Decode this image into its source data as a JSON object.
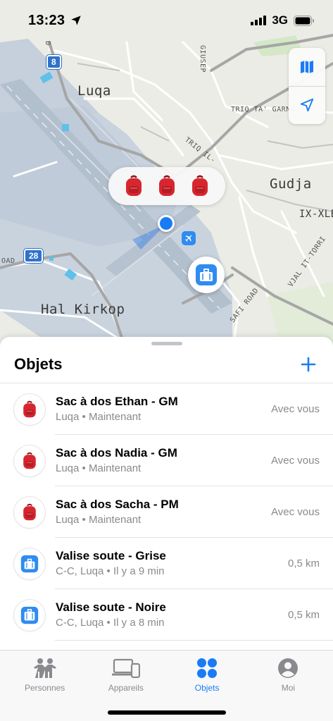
{
  "status_bar": {
    "time": "13:23",
    "network": "3G",
    "icons": [
      "location-arrow-icon",
      "signal-bars-icon",
      "battery-icon"
    ]
  },
  "map": {
    "labels": {
      "luqa": "Luqa",
      "gudja": "Gudja",
      "hal_kirkop": "Hal Kirkop",
      "triq_ta_garna": "TRIQ TA' GARNA",
      "triq_il": "TRIQ IL-",
      "ix_xlej": "IX-XLEJ",
      "oad": "OAD",
      "safi_road": "SAFI ROAD",
      "vjal_it_torri": "VJAL IT-TORRI",
      "giuseppe": "GIUSEP",
      "road_d": "D"
    },
    "route_shields": {
      "top": "8",
      "left": "28"
    },
    "controls": [
      "map-mode-icon",
      "locate-me-icon"
    ],
    "cluster_items": [
      "backpack-icon",
      "backpack-icon",
      "backpack-icon"
    ]
  },
  "sheet": {
    "title": "Objets",
    "add_icon": "plus-icon",
    "items": [
      {
        "name": "Sac à dos Ethan - GM",
        "place": "Luqa",
        "time": "Maintenant",
        "status": "Avec vous",
        "icon": "backpack-icon"
      },
      {
        "name": "Sac à dos Nadia - GM",
        "place": "Luqa",
        "time": "Maintenant",
        "status": "Avec vous",
        "icon": "backpack-icon"
      },
      {
        "name": "Sac à dos Sacha - PM",
        "place": "Luqa",
        "time": "Maintenant",
        "status": "Avec vous",
        "icon": "backpack-icon"
      },
      {
        "name": "Valise soute - Grise",
        "place": "C-C, Luqa",
        "time": "Il y a 9 min",
        "status": "0,5 km",
        "icon": "suitcase-icon"
      },
      {
        "name": "Valise soute - Noire",
        "place": "C-C, Luqa",
        "time": "Il y a 8 min",
        "status": "0,5 km",
        "icon": "suitcase-icon"
      }
    ],
    "separator": "•"
  },
  "tab_bar": {
    "tabs": [
      {
        "label": "Personnes",
        "icon": "people-icon",
        "active": false
      },
      {
        "label": "Appareils",
        "icon": "devices-icon",
        "active": false
      },
      {
        "label": "Objets",
        "icon": "items-grid-icon",
        "active": true
      },
      {
        "label": "Moi",
        "icon": "person-circle-icon",
        "active": false
      }
    ]
  },
  "colors": {
    "accent": "#1a7cf5",
    "backpack": "#d8262f",
    "suitcase": "#2f8cf0",
    "secondary_text": "#8a8a8e"
  }
}
